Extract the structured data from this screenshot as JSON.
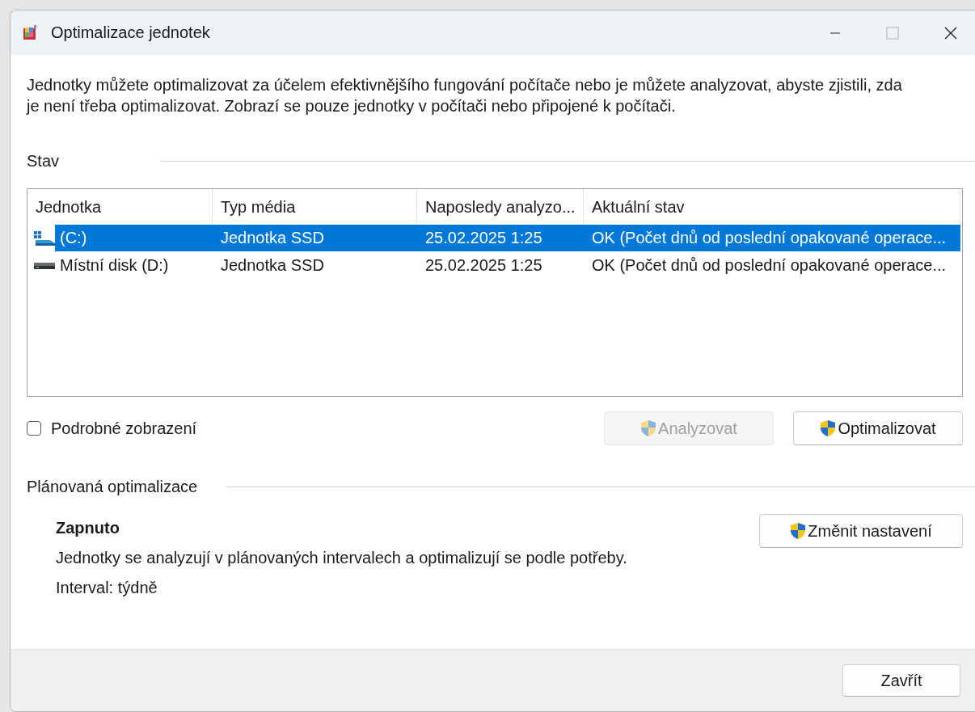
{
  "window": {
    "title": "Optimalizace jednotek"
  },
  "description": "Jednotky můžete optimalizovat za účelem efektivnějšího fungování počítače nebo je můžete analyzovat, abyste zjistili, zda je není třeba optimalizovat. Zobrazí se pouze jednotky v počítači nebo připojené k počítači.",
  "status_section": {
    "label": "Stav"
  },
  "table": {
    "columns": [
      "Jednotka",
      "Typ média",
      "Naposledy analyzo...",
      "Aktuální stav"
    ],
    "rows": [
      {
        "kind": "system",
        "selected": true,
        "cells": [
          "(C:)",
          "Jednotka SSD",
          "25.02.2025 1:25",
          "OK (Počet dnů od poslední opakované operace..."
        ]
      },
      {
        "kind": "disk",
        "selected": false,
        "cells": [
          "Místní disk (D:)",
          "Jednotka SSD",
          "25.02.2025 1:25",
          "OK (Počet dnů od poslední opakované operace..."
        ]
      }
    ]
  },
  "detail_view": {
    "label": "Podrobné zobrazení",
    "checked": false
  },
  "actions": [
    {
      "label": "Analyzovat",
      "disabled": true
    },
    {
      "label": "Optimalizovat",
      "disabled": false
    }
  ],
  "schedule": {
    "label": "Plánovaná optimalizace",
    "state": "Zapnuto",
    "description": "Jednotky se analyzují v plánovaných intervalech a optimalizují se podle potřeby.",
    "interval": "Interval: týdně",
    "button": "Změnit nastavení"
  },
  "footer": {
    "close_button": "Zavřít"
  }
}
